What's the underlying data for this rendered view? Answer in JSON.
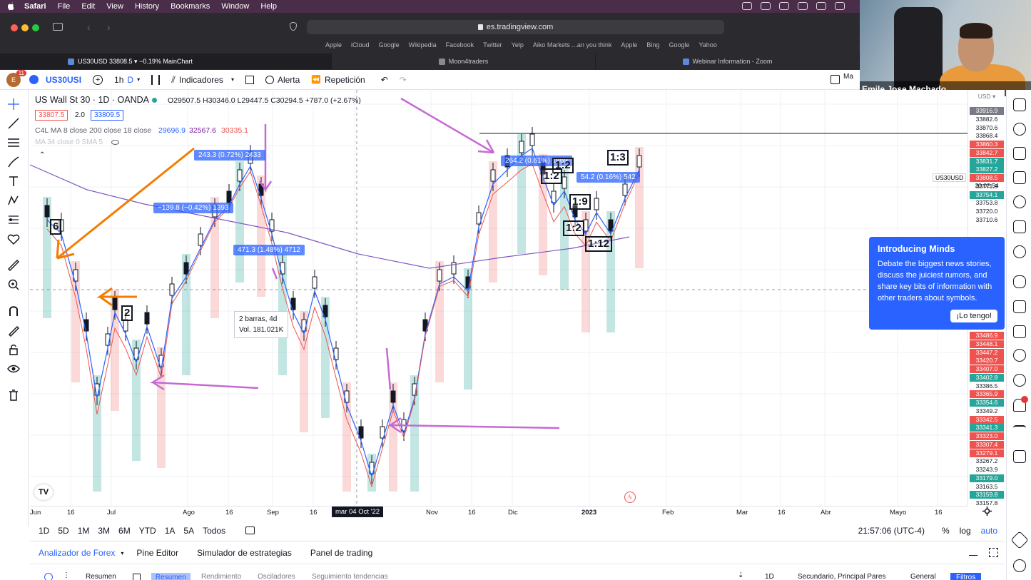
{
  "mac_menu": {
    "app": "Safari",
    "items": [
      "File",
      "Edit",
      "View",
      "History",
      "Bookmarks",
      "Window",
      "Help"
    ]
  },
  "browser": {
    "url": "es.tradingview.com",
    "favorites": [
      "Apple",
      "iCloud",
      "Google",
      "Wikipedia",
      "Facebook",
      "Twitter",
      "Yelp",
      "Aiko Markets ...an you think",
      "Apple",
      "Bing",
      "Google",
      "Yahoo"
    ],
    "tabs": [
      "US30USD 33808.5 ▾ −0.19% MainChart",
      "Moon4traders",
      "Webinar Information - Zoom"
    ]
  },
  "webcam": {
    "name": "Emile Jose Machado ..."
  },
  "toolbar": {
    "notif_count": "11",
    "symbol": "US30USI",
    "interval": "1h",
    "interval_mode": "D",
    "indicators": "Indicadores",
    "alert": "Alerta",
    "replay": "Repetición",
    "trailing": "Ma"
  },
  "legend": {
    "title": "US Wall St 30 · 1D · OANDA",
    "ohlc": "O29507.5  H30346.0  L29447.5  C30294.5  +787.0 (+2.67%)",
    "bid": "33807.5",
    "spread": "2.0",
    "ask": "33809.5",
    "ma_label": "C4L MA 8 close 200 close 18 close",
    "ma_v1": "29696.9",
    "ma_v2": "32567.6",
    "ma_v3": "30335.1",
    "ma2_label": "MA 34 close 0 SMA 5"
  },
  "measures": [
    "243.3 (0.72%) 2433",
    "−139.8 (−0.42%) 1393",
    "471.3 (1.48%) 4712",
    "264.2 (0.61%) 1869",
    "54.2 (0.16%) 542"
  ],
  "tooltip": {
    "line1": "2 barras, 4d",
    "line2": "Vol. 181.021K"
  },
  "boxes": [
    "6",
    "2",
    "1:3",
    "1:2",
    "1:3",
    "1:2",
    "1:9",
    "1:2",
    "1:12"
  ],
  "price_scale": {
    "currency": "USD ▾",
    "symbol_tag": "US30USD",
    "last_price": "33808.5",
    "countdown": "20:02:54",
    "upper": [
      {
        "v": "33916.9",
        "c": "gray"
      },
      {
        "v": "33882.6",
        "c": "none"
      },
      {
        "v": "33870.6",
        "c": "none"
      },
      {
        "v": "33868.4",
        "c": "none"
      },
      {
        "v": "33860.3",
        "c": "red"
      },
      {
        "v": "33842.7",
        "c": "red"
      },
      {
        "v": "33831.7",
        "c": "green"
      },
      {
        "v": "33827.2",
        "c": "green"
      },
      {
        "v": "33774.1",
        "c": "red"
      },
      {
        "v": "33771.9",
        "c": "none"
      },
      {
        "v": "33754.1",
        "c": "green"
      },
      {
        "v": "33753.8",
        "c": "none"
      },
      {
        "v": "33720.0",
        "c": "none"
      },
      {
        "v": "33710.6",
        "c": "none"
      }
    ],
    "lower": [
      {
        "v": "33486.9",
        "c": "red"
      },
      {
        "v": "33448.1",
        "c": "red"
      },
      {
        "v": "33447.2",
        "c": "red"
      },
      {
        "v": "33420.7",
        "c": "red"
      },
      {
        "v": "33407.0",
        "c": "red"
      },
      {
        "v": "33402.8",
        "c": "green"
      },
      {
        "v": "33386.5",
        "c": "none"
      },
      {
        "v": "33365.9",
        "c": "red"
      },
      {
        "v": "33354.6",
        "c": "green"
      },
      {
        "v": "33349.2",
        "c": "none"
      },
      {
        "v": "33342.5",
        "c": "red"
      },
      {
        "v": "33341.3",
        "c": "green"
      },
      {
        "v": "33323.0",
        "c": "red"
      },
      {
        "v": "33307.4",
        "c": "red"
      },
      {
        "v": "33279.1",
        "c": "red"
      },
      {
        "v": "33267.2",
        "c": "none"
      },
      {
        "v": "33243.9",
        "c": "none"
      },
      {
        "v": "33179.0",
        "c": "green"
      },
      {
        "v": "33163.5",
        "c": "none"
      },
      {
        "v": "33159.8",
        "c": "green"
      },
      {
        "v": "33157.8",
        "c": "none"
      }
    ]
  },
  "minds": {
    "title": "Introducing Minds",
    "body": "Debate the biggest news stories, discuss the juiciest rumors, and share key bits of information with other traders about symbols.",
    "button": "¡Lo tengo!"
  },
  "time_axis": {
    "labels": [
      "Jun",
      "16",
      "Jul",
      "Ago",
      "16",
      "Sep",
      "16",
      "Nov",
      "16",
      "Dic",
      "2023",
      "Feb",
      "Mar",
      "16",
      "Abr",
      "Mayo",
      "16"
    ],
    "crosshair": "mar 04 Oct '22"
  },
  "ranges": [
    "1D",
    "5D",
    "1M",
    "3M",
    "6M",
    "YTD",
    "1A",
    "5A",
    "Todos"
  ],
  "clock": "21:57:06 (UTC-4)",
  "scale_opts": [
    "%",
    "log",
    "auto"
  ],
  "panels": [
    "Analizador de Forex",
    "Pine Editor",
    "Simulador de estrategias",
    "Panel de trading"
  ],
  "subbar": {
    "left": [
      "Resumen",
      "Resumen",
      "Rendimiento",
      "Osciladores",
      "Seguimiento tendencias"
    ],
    "right": [
      "1D",
      "Secundario, Principal Pares",
      "General",
      "Filtros"
    ]
  },
  "colors": {
    "accent": "#2962ff",
    "up": "#26a69a",
    "down": "#ef5350",
    "annotation": "#c66ad3",
    "arrow": "#f57c00"
  }
}
